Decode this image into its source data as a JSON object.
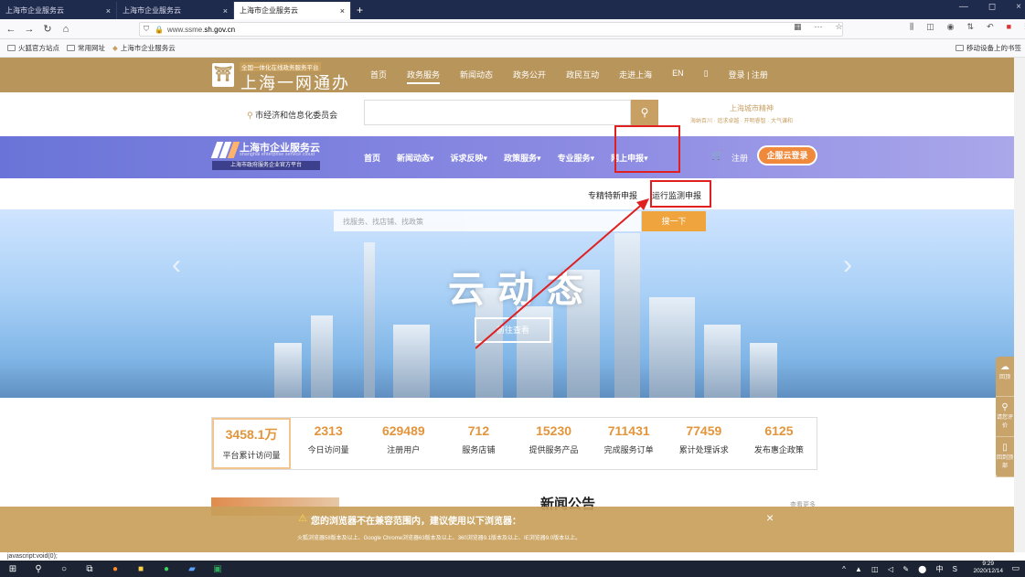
{
  "browser": {
    "tabs": [
      {
        "label": "上海市企业服务云"
      },
      {
        "label": "上海市企业服务云"
      },
      {
        "label": "上海市企业服务云"
      }
    ],
    "new_tab": "+",
    "url_prefix": "www.ssme.",
    "url_host": "sh.gov.cn",
    "more": "···",
    "bookmarks": [
      {
        "label": "火狐官方站点"
      },
      {
        "label": "常用网址"
      },
      {
        "label": "上海市企业服务云"
      }
    ],
    "mobile_bookmarks": "移动设备上的书签",
    "status_text": "javascript:void(0);"
  },
  "topbar": {
    "logo_small": "全国一体化在线政务服务平台",
    "logo_big": "上海一网通办",
    "nav": [
      "首页",
      "政务服务",
      "新闻动态",
      "政务公开",
      "政民互动",
      "走进上海",
      "EN"
    ],
    "login": "登录 | 注册"
  },
  "search": {
    "location": "市经济和信息化委员会",
    "side_title": "上海城市精神",
    "side_sub": "海纳百川 · 追求卓越 · 开明睿智 · 大气谦和"
  },
  "cloud": {
    "title": "上海市企业服务云",
    "subtitle": "shanghai enterprise service cloud",
    "band": "上海市政府服务企业官方平台",
    "menu": [
      "首页",
      "新闻动态▾",
      "诉求反映▾",
      "政策服务▾",
      "专业服务▾",
      "网上申报▾"
    ],
    "register": "注册",
    "login_button": "企服云登录"
  },
  "submenu": {
    "item1": "专精特新申报",
    "item2": "运行监测申报"
  },
  "hero": {
    "search_placeholder": "找服务、找店铺、找政策",
    "search_button": "搜一下",
    "title": "云动态",
    "go_button": "前往查看"
  },
  "stats": [
    {
      "value": "3458.1万",
      "label": "平台累计访问量"
    },
    {
      "value": "2313",
      "label": "今日访问量"
    },
    {
      "value": "629489",
      "label": "注册用户"
    },
    {
      "value": "712",
      "label": "服务店铺"
    },
    {
      "value": "15230",
      "label": "提供服务产品"
    },
    {
      "value": "711431",
      "label": "完成服务订单"
    },
    {
      "value": "77459",
      "label": "累计处理诉求"
    },
    {
      "value": "6125",
      "label": "发布惠企政策"
    }
  ],
  "notice": {
    "title": "新闻公告",
    "more": "查看更多"
  },
  "warning": {
    "title": "您的浏览器不在兼容范围内，建议使用以下浏览器：",
    "text": "火狐浏览器58版本及以上、Google Chrome浏览器63版本及以上、360浏览器9.1版本及以上、IE浏览器9.0版本以上。"
  },
  "floatbar": [
    "回顶",
    "请您评价",
    "回到顶部"
  ],
  "taskbar": {
    "time": "9:29",
    "date": "2020/12/14",
    "ime": "中"
  }
}
